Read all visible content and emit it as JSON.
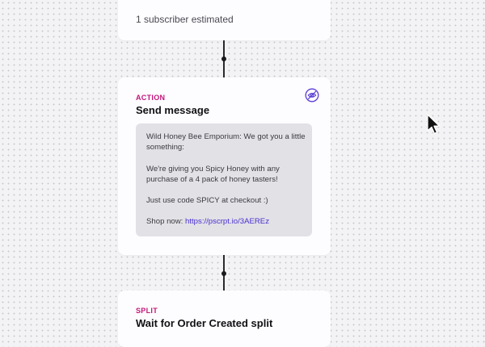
{
  "audience_card": {
    "estimate_text": "1 subscriber estimated"
  },
  "action_card": {
    "tag": "ACTION",
    "title": "Send message",
    "message": {
      "line1": "Wild Honey Bee Emporium: We got you a little something:",
      "line2": "We're giving you Spicy Honey with any purchase of a 4 pack of honey tasters!",
      "line3": "Just use code SPICY at checkout :)",
      "shop_prefix": "Shop now: ",
      "shop_link": "https://pscrpt.io/3AEREz"
    },
    "icon": "eye-off-icon"
  },
  "split_card": {
    "tag": "SPLIT",
    "title": "Wait for Order Created split"
  },
  "colors": {
    "accent_tag": "#c2177a",
    "link": "#4b2fd0",
    "icon": "#5a3fd6"
  }
}
